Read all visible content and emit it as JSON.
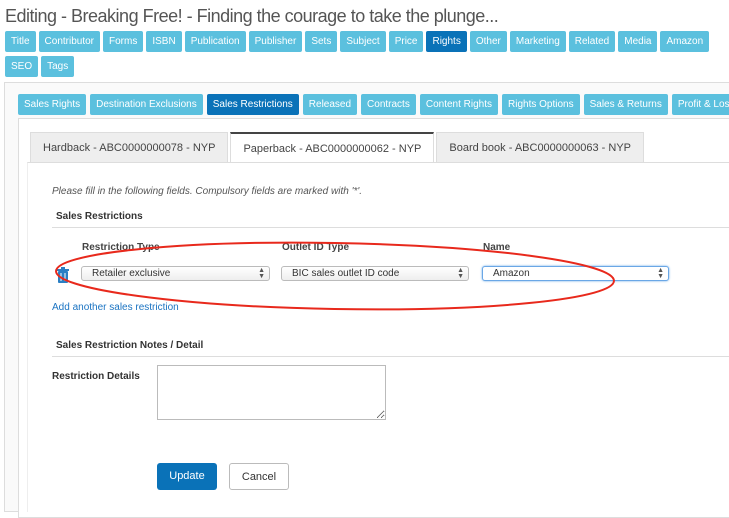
{
  "title": "Editing - Breaking Free! - Finding the courage to take the plunge...",
  "nav_row1": [
    "Title",
    "Contributor",
    "Forms",
    "ISBN",
    "Publication",
    "Publisher",
    "Sets",
    "Subject",
    "Price",
    "Rights",
    "Other",
    "Marketing",
    "Related",
    "Media",
    "Amazon"
  ],
  "nav_row2": [
    "SEO",
    "Tags"
  ],
  "nav_active": "Rights",
  "subtabs": [
    "Sales Rights",
    "Destination Exclusions",
    "Sales Restrictions",
    "Released",
    "Contracts",
    "Content Rights",
    "Rights Options",
    "Sales & Returns",
    "Profit & Loss"
  ],
  "subtab_active": "Sales Restrictions",
  "format_tabs": [
    "Hardback - ABC0000000078 - NYP",
    "Paperback - ABC0000000062 - NYP",
    "Board book - ABC0000000063 - NYP"
  ],
  "format_active": "Paperback - ABC0000000062 - NYP",
  "form": {
    "note": "Please fill in the following fields. Compulsory fields are marked with '*'.",
    "section1": "Sales Restrictions",
    "col_restriction_type": "Restriction Type",
    "col_outlet_id_type": "Outlet ID Type",
    "col_name": "Name",
    "restriction_type": "Retailer exclusive",
    "outlet_id_type": "BIC sales outlet ID code",
    "name": "Amazon",
    "add_link": "Add another sales restriction",
    "section2": "Sales Restriction Notes / Detail",
    "details_label": "Restriction Details",
    "details_value": "",
    "update": "Update",
    "cancel": "Cancel"
  },
  "colors": {
    "button": "#5bc0de",
    "active": "#0a72b8",
    "annotation": "#e8291c"
  }
}
